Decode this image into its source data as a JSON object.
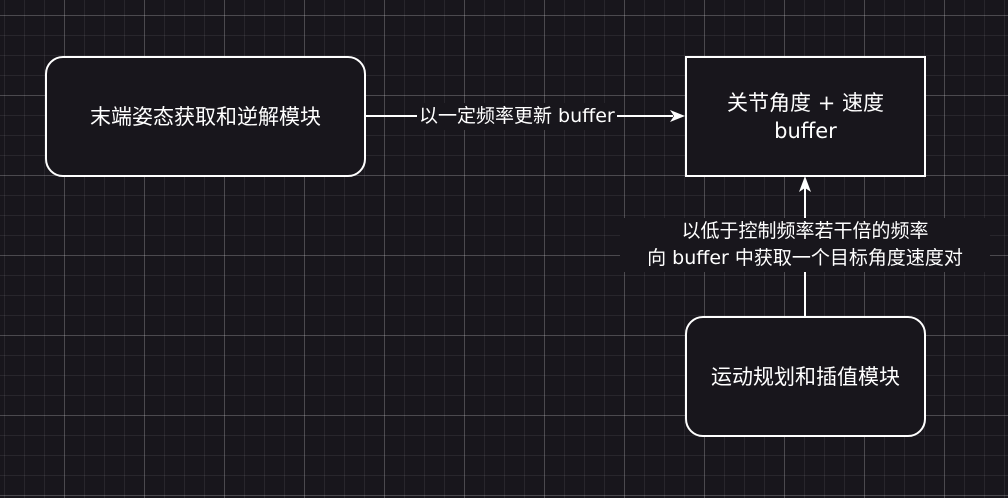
{
  "nodes": {
    "pose_module": "末端姿态获取和逆解模块",
    "buffer_line1": "关节角度 + 速度",
    "buffer_line2": "buffer",
    "planning_module": "运动规划和插值模块"
  },
  "edges": {
    "update_label": "以一定频率更新 buffer",
    "fetch_label_line1": "以低于控制频率若干倍的频率",
    "fetch_label_line2": "向 buffer 中获取一个目标角度速度对"
  }
}
